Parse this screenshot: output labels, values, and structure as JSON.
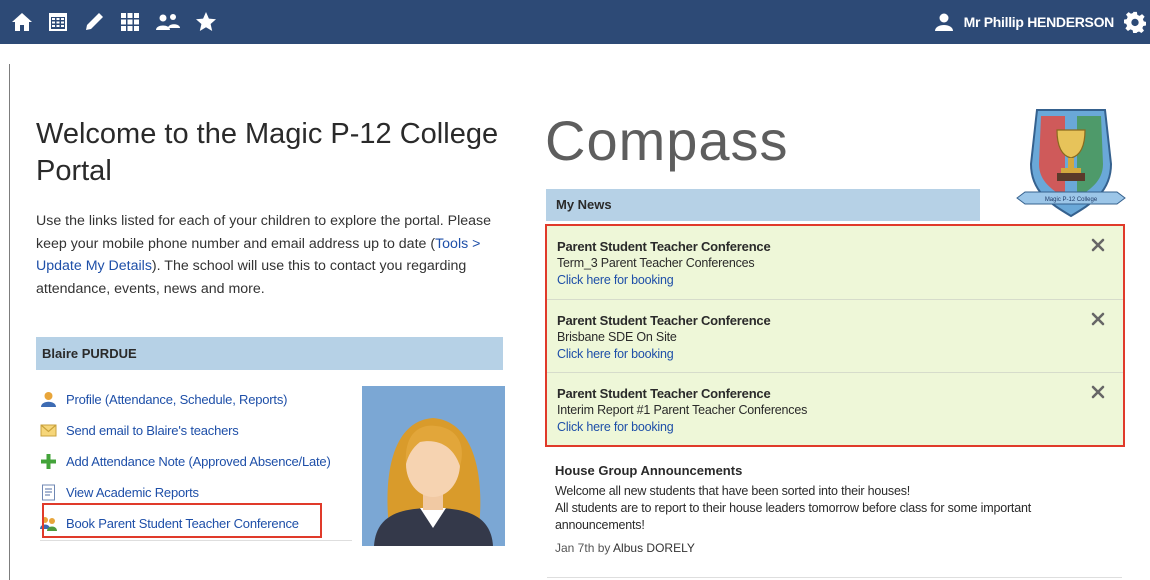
{
  "topbar": {
    "icons": [
      "home-icon",
      "calendar-icon",
      "pencil-icon",
      "grid-icon",
      "people-icon",
      "star-icon"
    ],
    "user_name": "Mr Phillip HENDERSON",
    "bg_color": "#2d4a76"
  },
  "welcome": {
    "title": "Welcome to the Magic P-12 College Portal",
    "text_before": "Use the links listed for each of your children to explore the portal. Please keep your mobile phone number and email address up to date (",
    "tools_link": "Tools > Update My Details",
    "text_after": "). The school will use this to contact you regarding attendance, events, news and more."
  },
  "student": {
    "name": "Blaire PURDUE",
    "links": [
      {
        "label": "Profile (Attendance, Schedule, Reports)",
        "icon": "profile-icon"
      },
      {
        "label": "Send email to Blaire's teachers",
        "icon": "email-icon"
      },
      {
        "label": "Add Attendance Note (Approved Absence/Late)",
        "icon": "plus-icon"
      },
      {
        "label": "View Academic Reports",
        "icon": "report-icon"
      },
      {
        "label": "Book Parent Student Teacher Conference",
        "icon": "conference-icon"
      }
    ]
  },
  "brand": {
    "title": "Compass",
    "crest_text": "Magic P-12 College"
  },
  "news": {
    "header": "My News",
    "items": [
      {
        "title": "Parent Student Teacher Conference",
        "subtitle": "Term_3 Parent Teacher Conferences",
        "link": "Click here for booking"
      },
      {
        "title": "Parent Student Teacher Conference",
        "subtitle": "Brisbane SDE On Site",
        "link": "Click here for booking"
      },
      {
        "title": "Parent Student Teacher Conference",
        "subtitle": "Interim Report #1 Parent Teacher Conferences",
        "link": "Click here for booking"
      }
    ]
  },
  "house": {
    "title": "House Group Announcements",
    "line1": "Welcome all new students that have been sorted into their houses!",
    "line2": "All students are to report to their house leaders tomorrow before class for some important announcements!",
    "date": "Jan 7th by",
    "author": "Albus DORELY"
  },
  "colors": {
    "accent_link": "#1e4fa8",
    "header_blue": "#b6d1e6",
    "news_bg": "#eef7d8",
    "highlight_red": "#e03a2a"
  }
}
